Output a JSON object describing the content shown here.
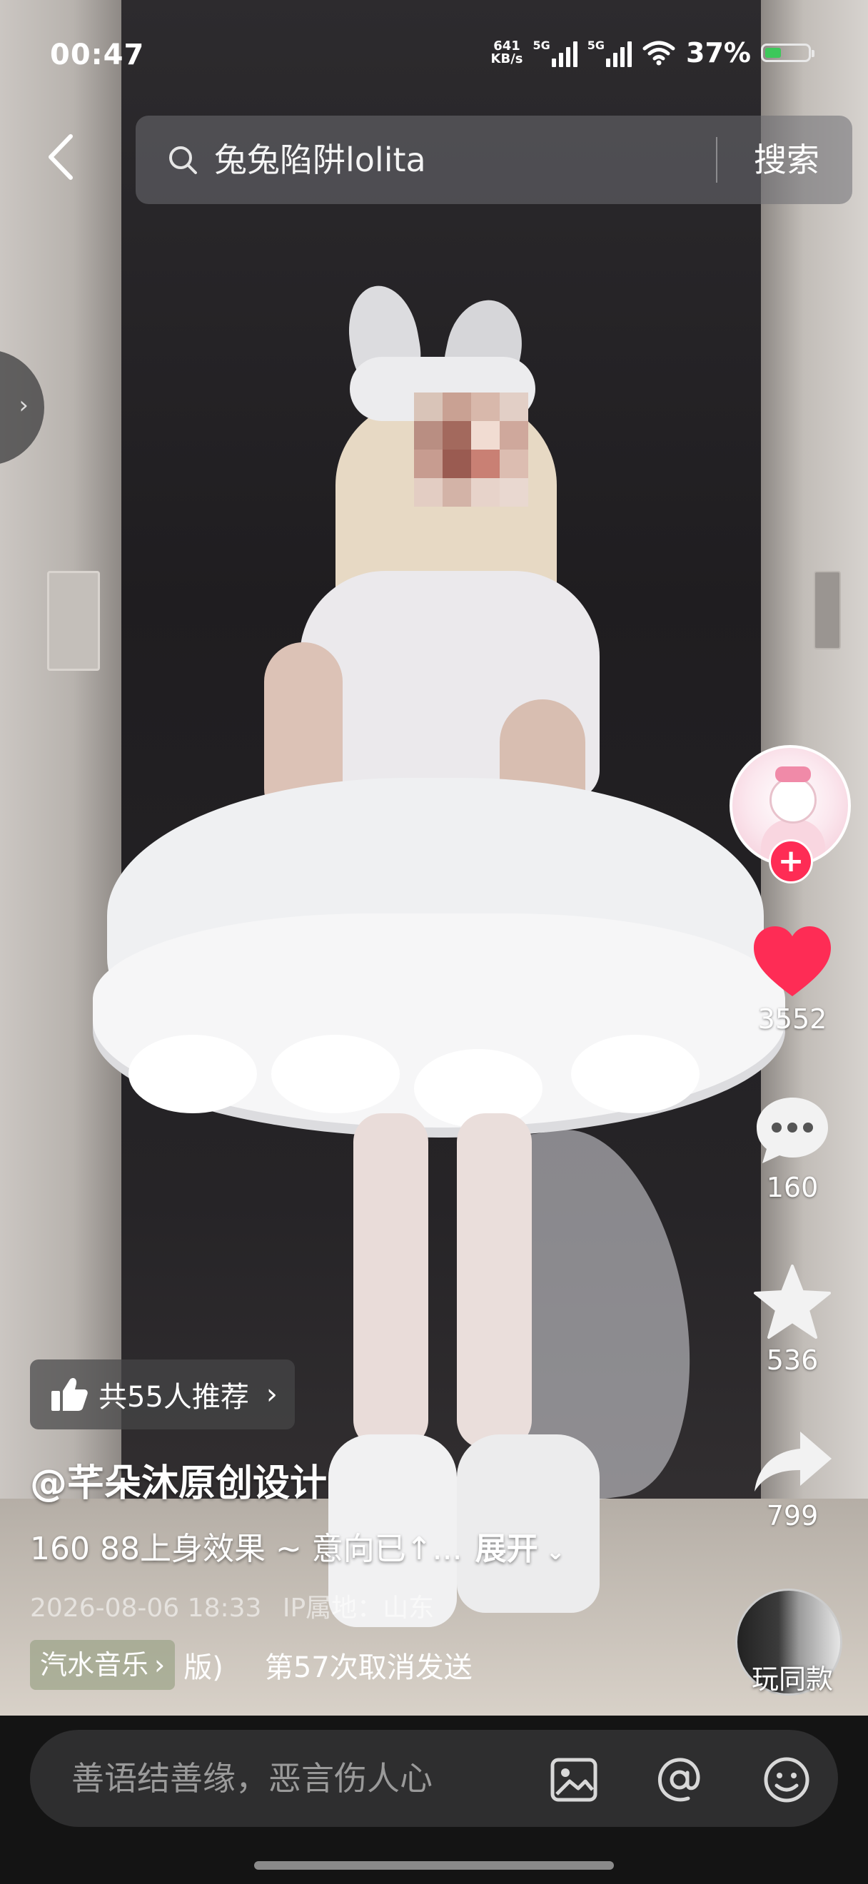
{
  "status_bar": {
    "time": "00:47",
    "net_speed_value": "641",
    "net_speed_unit": "KB/s",
    "sim1_label": "5G",
    "sim2_label": "5G",
    "battery_percent": "37%"
  },
  "search": {
    "query": "兔兔陷阱lolita",
    "button_label": "搜索"
  },
  "side_tab": {
    "icon": "chevron-right-icon"
  },
  "actions": {
    "likes": "3552",
    "comments": "160",
    "favorites": "536",
    "shares": "799",
    "follow_symbol": "+",
    "same_style_label": "玩同款",
    "colors": {
      "like": "#fe2c55",
      "follow": "#fe2c55"
    }
  },
  "video_info": {
    "recommend_label": "共55人推荐",
    "author": "@芊朵沐原创设计",
    "caption": "160 88上身效果 ~ 意向已↑...",
    "expand_label": "展开",
    "date": "2026-08-06 18:33",
    "location": "IP属地：山东",
    "music_app_label": "汽水音乐",
    "music_fragment": "版)",
    "music_title": "第57次取消发送"
  },
  "comment_bar": {
    "placeholder": "善语结善缘，恶言伤人心",
    "icons": [
      "image-icon",
      "at-icon",
      "emoji-icon"
    ]
  }
}
